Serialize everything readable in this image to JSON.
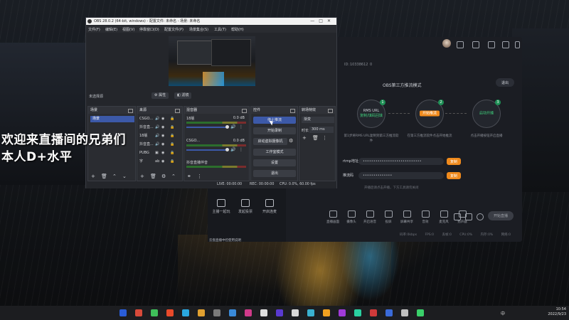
{
  "overlay": {
    "line1": "欢迎来直播间的兄弟们",
    "line2": "本人D+水平"
  },
  "obs": {
    "title": "OBS 28.0.2 (64-bit, windows) - 配置文件: 未命名 - 场景: 未命名",
    "menu": [
      "文件(F)",
      "编辑(E)",
      "视图(V)",
      "停靠窗口(D)",
      "配置文件(P)",
      "场景集合(S)",
      "工具(T)",
      "帮助(H)"
    ],
    "no_source": "未选择源",
    "properties_btn": "属性",
    "filters_btn": "滤镜",
    "docks": {
      "scenes": {
        "title": "场景",
        "items": [
          "场景"
        ]
      },
      "sources": {
        "title": "来源",
        "items": [
          "CSGO...",
          "抖音直...",
          "18版",
          "抖音直...",
          "PUBG",
          "字"
        ]
      },
      "mixer": {
        "title": "混音器",
        "rows": [
          {
            "name": "18版",
            "db": "0.0 dB"
          },
          {
            "name": "CSGO...",
            "db": "0.0 dB"
          },
          {
            "name": "抖音直播伴音",
            "db": "0.0 dB"
          }
        ]
      },
      "controls": {
        "title": "控件",
        "buttons": [
          "停止推流",
          "开始录制",
          "启动虚拟摄像机",
          "工作室模式",
          "设置",
          "退出"
        ]
      },
      "transitions": {
        "title": "转场特效",
        "type": "渐变",
        "duration_label": "时长",
        "duration": "300 ms"
      }
    },
    "status": {
      "live": "LIVE: 00:00:00",
      "rec": "REC: 00:00:00",
      "cpu": "CPU: 0.0%, 60.00 fps"
    }
  },
  "stream_app": {
    "uid_label": "ID:",
    "uid": "10338612",
    "follows": "0",
    "mode_title": "OBS第三方推流模式",
    "exit_label": "退出",
    "steps": [
      {
        "num": "1",
        "label": "RMS URL",
        "sub": "复制/填码回填",
        "desc": "第1步将RMS URL复制到第三方推流软件"
      },
      {
        "num": "2",
        "label": "开始推流",
        "sub": "",
        "desc": "在第三方推流软件点击开始推流"
      },
      {
        "num": "3",
        "label": "启动开播",
        "sub": "",
        "desc": "点击开播按钮开启直播"
      }
    ],
    "rtmp_label": "rtmp地址",
    "rtmp_value": "••••••••••••••••••••••••••••",
    "key_label": "推流码",
    "key_value": "••••••••••••••",
    "copy_label": "复制",
    "hint": "开播后请点击开播，下方工具请勿关闭",
    "tools": [
      "直播画面",
      "摄像头",
      "开启语音",
      "投屏",
      "屏幕共享",
      "音效",
      "麦克风",
      "扬声器"
    ],
    "go_live": "开始直播",
    "statusbar": [
      "码率:0kbps",
      "FPS:0",
      "丢帧:0",
      "CPU:0%",
      "内存:0%",
      "网络:0"
    ],
    "left_items": [
      "主播一起玩",
      "发起投票",
      "开启连麦"
    ],
    "left_note": "云盘直播中控使用说明"
  },
  "taskbar": {
    "time": "10:54",
    "date": "2022/9/23",
    "ime": "中",
    "icon_colors": [
      "#2a5dd8",
      "#d84a3a",
      "#3fbf5a",
      "#e84a2a",
      "#2aa8e0",
      "#e0a030",
      "#7a7a7a",
      "#3a8ad8",
      "#d03a8a",
      "#e0e0e0",
      "#5a3ad0",
      "#d8d8d8",
      "#3ab0d0",
      "#f0a020",
      "#a03ad8",
      "#2ad0a0",
      "#d03a3a",
      "#3a6ad8",
      "#c0c0c0",
      "#3ad06a"
    ]
  }
}
